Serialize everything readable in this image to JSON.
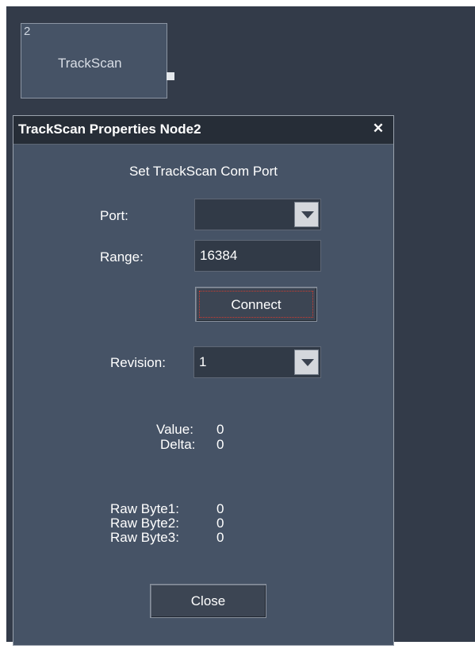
{
  "node": {
    "id": "2",
    "title": "TrackScan"
  },
  "dialog": {
    "title": "TrackScan Properties Node2",
    "close_icon": "close-x-icon",
    "heading": "Set TrackScan Com Port",
    "port": {
      "label": "Port:",
      "value": ""
    },
    "range": {
      "label": "Range:",
      "value": "16384"
    },
    "connect_label": "Connect",
    "revision": {
      "label": "Revision:",
      "value": "1"
    },
    "value": {
      "label": "Value:",
      "value": "0"
    },
    "delta": {
      "label": "Delta:",
      "value": "0"
    },
    "raw": [
      {
        "label": "Raw Byte1:",
        "value": "0"
      },
      {
        "label": "Raw Byte2:",
        "value": "0"
      },
      {
        "label": "Raw Byte3:",
        "value": "0"
      }
    ],
    "close_label": "Close"
  },
  "colors": {
    "canvas": "#333b49",
    "panel": "#465366",
    "titlebar": "#262d37",
    "focus": "#d23a2e"
  }
}
